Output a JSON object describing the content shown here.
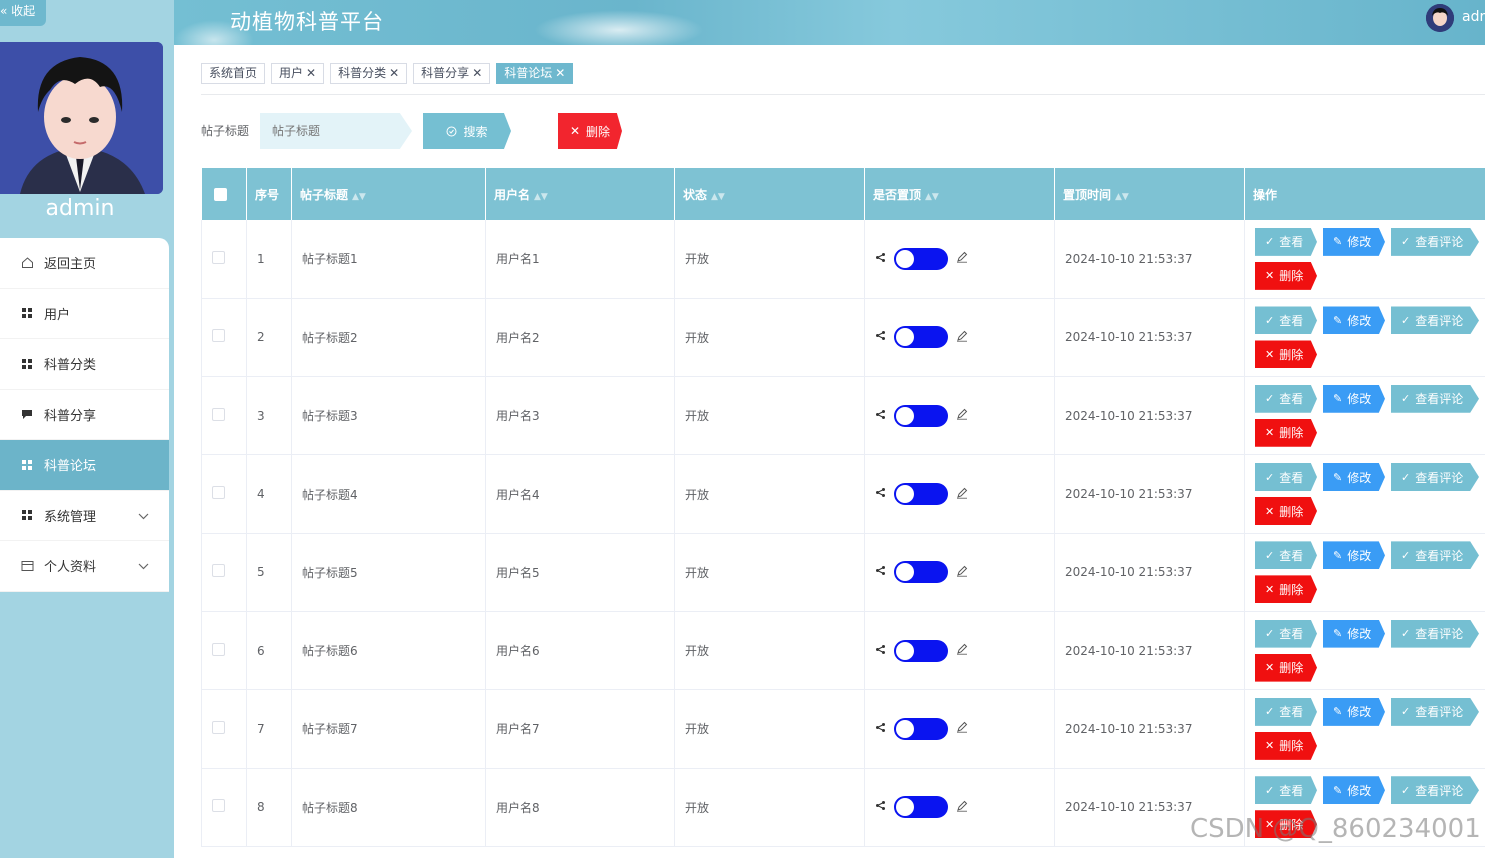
{
  "sidebar": {
    "collapse_label": "« 收起",
    "admin_name": "admin",
    "menu": [
      {
        "label": "返回主页",
        "icon": "home-icon"
      },
      {
        "label": "用户",
        "icon": "grid-icon"
      },
      {
        "label": "科普分类",
        "icon": "grid-icon"
      },
      {
        "label": "科普分享",
        "icon": "chat-icon"
      },
      {
        "label": "科普论坛",
        "icon": "grid-icon"
      },
      {
        "label": "系统管理",
        "icon": "grid-icon"
      },
      {
        "label": "个人资料",
        "icon": "card-icon"
      }
    ]
  },
  "header": {
    "title": "动植物科普平台",
    "user": "adr"
  },
  "tabs": [
    {
      "label": "系统首页"
    },
    {
      "label": "用户"
    },
    {
      "label": "科普分类"
    },
    {
      "label": "科普分享"
    },
    {
      "label": "科普论坛"
    }
  ],
  "search": {
    "label": "帖子标题",
    "placeholder": "帖子标题",
    "search_button": "搜索",
    "delete_button": "删除"
  },
  "table": {
    "headers": [
      "序号",
      "帖子标题",
      "用户名",
      "状态",
      "是否置顶",
      "置顶时间",
      "操作"
    ],
    "rows": [
      {
        "index": "1",
        "title": "帖子标题1",
        "user": "用户名1",
        "status": "开放",
        "time": "2024-10-10 21:53:37"
      },
      {
        "index": "2",
        "title": "帖子标题2",
        "user": "用户名2",
        "status": "开放",
        "time": "2024-10-10 21:53:37"
      },
      {
        "index": "3",
        "title": "帖子标题3",
        "user": "用户名3",
        "status": "开放",
        "time": "2024-10-10 21:53:37"
      },
      {
        "index": "4",
        "title": "帖子标题4",
        "user": "用户名4",
        "status": "开放",
        "time": "2024-10-10 21:53:37"
      },
      {
        "index": "5",
        "title": "帖子标题5",
        "user": "用户名5",
        "status": "开放",
        "time": "2024-10-10 21:53:37"
      },
      {
        "index": "6",
        "title": "帖子标题6",
        "user": "用户名6",
        "status": "开放",
        "time": "2024-10-10 21:53:37"
      },
      {
        "index": "7",
        "title": "帖子标题7",
        "user": "用户名7",
        "status": "开放",
        "time": "2024-10-10 21:53:37"
      },
      {
        "index": "8",
        "title": "帖子标题8",
        "user": "用户名8",
        "status": "开放",
        "time": "2024-10-10 21:53:37"
      }
    ],
    "actions": {
      "view": "查看",
      "edit": "修改",
      "comments": "查看评论",
      "delete": "删除"
    }
  },
  "watermark": "CSDN @Q_860234001",
  "colors": {
    "accent": "#6eb8ce",
    "switch": "#0a14f0",
    "danger": "#f01010",
    "edit": "#3a9cf5"
  }
}
